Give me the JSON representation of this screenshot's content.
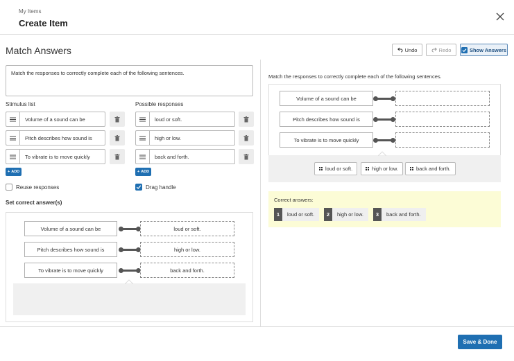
{
  "header": {
    "breadcrumb": "My Items",
    "title": "Create Item"
  },
  "toolbar": {
    "section_title": "Match Answers",
    "undo_label": "Undo",
    "redo_label": "Redo",
    "show_answers_label": "Show Answers"
  },
  "editor": {
    "stem": "Match the responses to correctly complete each of the following sentences.",
    "stimulus_label": "Stimulus list",
    "responses_label": "Possible responses",
    "stimulus": [
      "Volume of a sound can be",
      "Pitch describes how sound is",
      "To vibrate is to move quickly"
    ],
    "responses": [
      "loud or soft.",
      "high or low.",
      "back and forth."
    ],
    "add_label": "ADD",
    "reuse_label": "Reuse responses",
    "drag_label": "Drag handle",
    "set_correct_label": "Set correct answer(s)"
  },
  "correct_setup": {
    "pairs": [
      {
        "stimulus": "Volume of a sound can be",
        "response": "loud or soft."
      },
      {
        "stimulus": "Pitch describes how sound is",
        "response": "high or low."
      },
      {
        "stimulus": "To vibrate is to move quickly",
        "response": "back and forth."
      }
    ]
  },
  "preview": {
    "stem": "Match the responses to correctly complete each of the following sentences.",
    "stimulus": [
      "Volume of a sound can be",
      "Pitch describes how sound is",
      "To vibrate is to move quickly"
    ],
    "chips": [
      "loud or soft.",
      "high or low.",
      "back and forth."
    ],
    "correct_label": "Correct answers:",
    "answers": [
      {
        "num": "1",
        "text": "loud or soft."
      },
      {
        "num": "2",
        "text": "high or low."
      },
      {
        "num": "3",
        "text": "back and forth."
      }
    ]
  },
  "footer": {
    "save_label": "Save & Done"
  },
  "colors": {
    "accent": "#1f6fb2",
    "correct_bg": "#fcfcd6",
    "connector": "#555555"
  }
}
